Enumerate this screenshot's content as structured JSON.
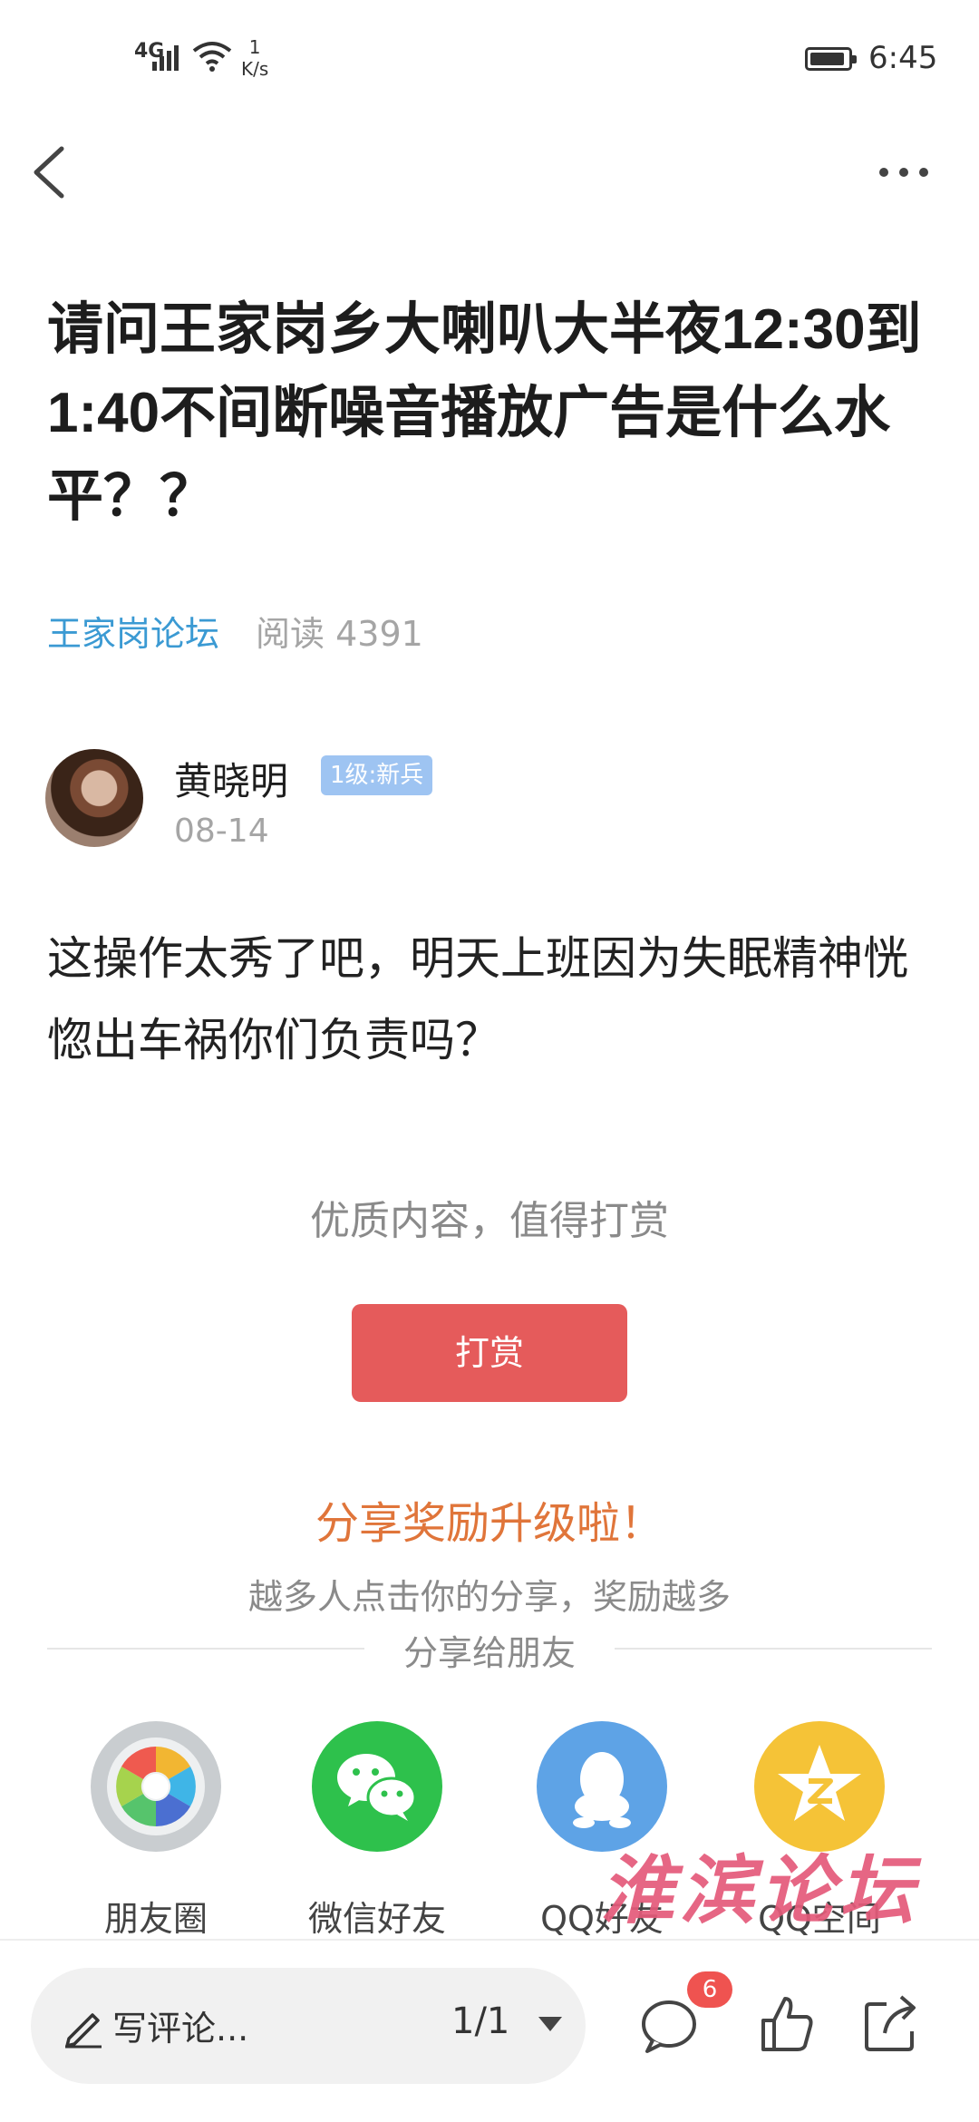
{
  "status_bar": {
    "network": "4G",
    "speed_value": "1",
    "speed_unit": "K/s",
    "time": "6:45"
  },
  "post": {
    "title": "请问王家岗乡大喇叭大半夜12:30到1:40不间断噪音播放广告是什么水平？？",
    "forum": "王家岗论坛",
    "read_count": "阅读 4391",
    "author": "黄晓明",
    "author_badge": "1级:新兵",
    "date": "08-14",
    "content": "这操作太秀了吧，明天上班因为失眠精神恍惚出车祸你们负责吗？"
  },
  "reward": {
    "tip": "优质内容，值得打赏",
    "button_label": "打赏"
  },
  "share": {
    "title": "分享奖励升级啦！",
    "subtitle": "越多人点击你的分享，奖励越多",
    "share_to": "分享给朋友",
    "targets": [
      {
        "label": "朋友圈",
        "icon": "moments-icon",
        "color": "#c9cdd0"
      },
      {
        "label": "微信好友",
        "icon": "wechat-icon",
        "color": "#2ec14c"
      },
      {
        "label": "QQ好友",
        "icon": "qq-icon",
        "color": "#5ea3e6"
      },
      {
        "label": "QQ空间",
        "icon": "qzone-icon",
        "color": "#f5c337"
      }
    ]
  },
  "watermark": "淮滨论坛",
  "bottom_bar": {
    "comment_placeholder": "写评论...",
    "page_indicator": "1/1",
    "comment_count": "6"
  }
}
